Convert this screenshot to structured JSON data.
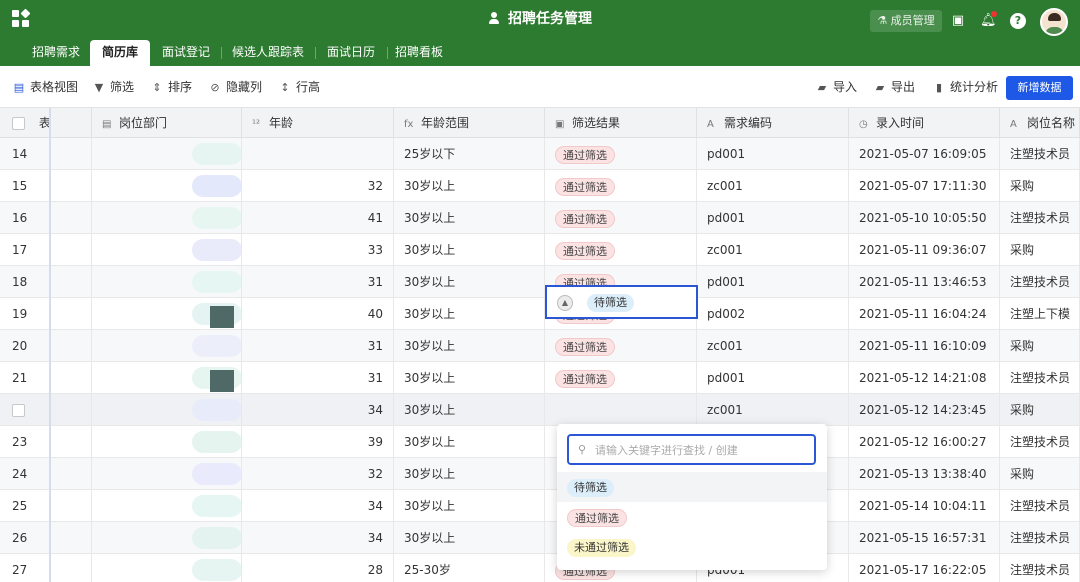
{
  "app": {
    "title": "招聘任务管理",
    "member_button": "成员管理"
  },
  "tabs": [
    "招聘需求",
    "简历库",
    "面试登记",
    "候选人跟踪表",
    "面试日历",
    "招聘看板"
  ],
  "active_tab": 1,
  "toolbar": {
    "grid_view": "表格视图",
    "filter": "筛选",
    "sort": "排序",
    "hide_cols": "隐藏列",
    "row_height": "行高",
    "import": "导入",
    "export": "导出",
    "analytics": "统计分析",
    "add": "新增数据"
  },
  "columns": {
    "c0": "表",
    "dept": "岗位部门",
    "age": "年龄",
    "range": "年龄范围",
    "result": "筛选结果",
    "code": "需求编码",
    "time": "录入时间",
    "pos": "岗位名称"
  },
  "rows": [
    {
      "idx": "14",
      "age": "",
      "range": "25岁以下",
      "result": "通过筛选",
      "code": "pd001",
      "time": "2021-05-07 16:09:05",
      "pos": "注塑技术员"
    },
    {
      "idx": "15",
      "age": "32",
      "range": "30岁以上",
      "result": "通过筛选",
      "code": "zc001",
      "time": "2021-05-07 17:11:30",
      "pos": "采购"
    },
    {
      "idx": "16",
      "age": "41",
      "range": "30岁以上",
      "result": "通过筛选",
      "code": "pd001",
      "time": "2021-05-10 10:05:50",
      "pos": "注塑技术员"
    },
    {
      "idx": "17",
      "age": "33",
      "range": "30岁以上",
      "result": "通过筛选",
      "code": "zc001",
      "time": "2021-05-11 09:36:07",
      "pos": "采购"
    },
    {
      "idx": "18",
      "age": "31",
      "range": "30岁以上",
      "result": "通过筛选",
      "code": "pd001",
      "time": "2021-05-11 13:46:53",
      "pos": "注塑技术员"
    },
    {
      "idx": "19",
      "age": "40",
      "range": "30岁以上",
      "result": "通过筛选",
      "code": "pd002",
      "time": "2021-05-11 16:04:24",
      "pos": "注塑上下模"
    },
    {
      "idx": "20",
      "age": "31",
      "range": "30岁以上",
      "result": "通过筛选",
      "code": "zc001",
      "time": "2021-05-11 16:10:09",
      "pos": "采购"
    },
    {
      "idx": "21",
      "age": "31",
      "range": "30岁以上",
      "result": "通过筛选",
      "code": "pd001",
      "time": "2021-05-12 14:21:08",
      "pos": "注塑技术员"
    },
    {
      "idx": "",
      "age": "34",
      "range": "30岁以上",
      "result": "待筛选",
      "code": "zc001",
      "time": "2021-05-12 14:23:45",
      "pos": "采购"
    },
    {
      "idx": "23",
      "age": "39",
      "range": "30岁以上",
      "result": "",
      "code": "",
      "time": "2021-05-12 16:00:27",
      "pos": "注塑技术员"
    },
    {
      "idx": "24",
      "age": "32",
      "range": "30岁以上",
      "result": "",
      "code": "",
      "time": "2021-05-13 13:38:40",
      "pos": "采购"
    },
    {
      "idx": "25",
      "age": "34",
      "range": "30岁以上",
      "result": "",
      "code": "",
      "time": "2021-05-14 10:04:11",
      "pos": "注塑技术员"
    },
    {
      "idx": "26",
      "age": "34",
      "range": "30岁以上",
      "result": "",
      "code": "",
      "time": "2021-05-15 16:57:31",
      "pos": "注塑技术员"
    },
    {
      "idx": "27",
      "age": "28",
      "range": "25-30岁",
      "result": "通过筛选",
      "code": "pd001",
      "time": "2021-05-17 16:22:05",
      "pos": "注塑技术员"
    }
  ],
  "dropdown": {
    "placeholder": "请输入关键字进行查找 / 创建",
    "options": [
      "待筛选",
      "通过筛选",
      "未通过筛选"
    ]
  },
  "colors": {
    "brand": "#2d7a31",
    "accent": "#1d59e6",
    "pass": "#fbe3e3",
    "pending": "#dbeefa",
    "fail": "#fbf6c9"
  }
}
